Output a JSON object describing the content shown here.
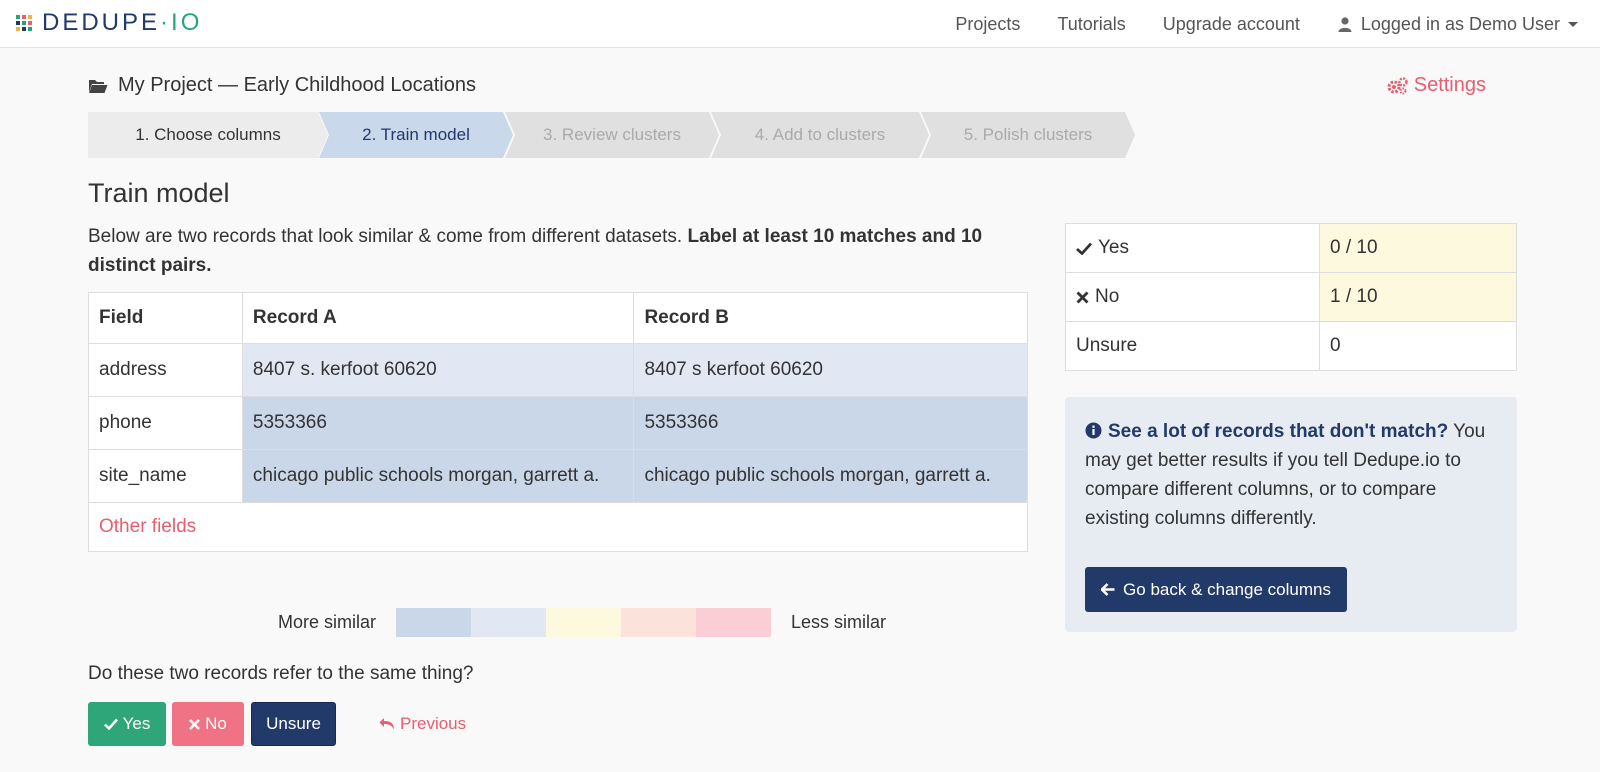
{
  "navbar": {
    "logo": {
      "main": "DEDUPE",
      "sep": "·",
      "suffix": "IO"
    },
    "links": [
      "Projects",
      "Tutorials",
      "Upgrade account"
    ],
    "user_label": "Logged in as Demo User"
  },
  "project": {
    "title": "My Project — Early Childhood Locations",
    "settings_label": "Settings"
  },
  "steps": [
    {
      "label": "1. Choose columns",
      "state": "done"
    },
    {
      "label": "2. Train model",
      "state": "active"
    },
    {
      "label": "3. Review clusters",
      "state": "pending"
    },
    {
      "label": "4. Add to clusters",
      "state": "pending"
    },
    {
      "label": "5. Polish clusters",
      "state": "pending"
    }
  ],
  "heading": "Train model",
  "intro": {
    "text": "Below are two records that look similar & come from different datasets. ",
    "bold": "Label at least 10 matches and 10 distinct pairs."
  },
  "compare": {
    "headers": [
      "Field",
      "Record A",
      "Record B"
    ],
    "rows": [
      {
        "field": "address",
        "a": "8407 s. kerfoot 60620",
        "b": "8407 s kerfoot 60620",
        "similarity": 2
      },
      {
        "field": "phone",
        "a": "5353366",
        "b": "5353366",
        "similarity": 1
      },
      {
        "field": "site_name",
        "a": "chicago public schools morgan, garrett a.",
        "b": "chicago public schools morgan, garrett a.",
        "similarity": 1
      }
    ],
    "other_fields_label": "Other fields"
  },
  "legend": {
    "more_label": "More similar",
    "less_label": "Less similar",
    "colors": [
      "#cad7e8",
      "#e2e8f3",
      "#fdf9df",
      "#fbe3db",
      "#fbcdd5"
    ]
  },
  "question": "Do these two records refer to the same thing?",
  "buttons": {
    "yes": "Yes",
    "no": "No",
    "unsure": "Unsure",
    "previous": "Previous"
  },
  "stats": [
    {
      "icon": "check-icon",
      "label": "Yes",
      "value": "0 / 10",
      "highlight": true
    },
    {
      "icon": "times-icon",
      "label": "No",
      "value": "1 / 10",
      "highlight": true
    },
    {
      "icon": "",
      "label": "Unsure",
      "value": "0",
      "highlight": false
    }
  ],
  "info": {
    "bold": "See a lot of records that don't match?",
    "text": " You may get better results if you tell Dedupe.io to compare different columns, or to compare existing columns differently.",
    "button": "Go back & change columns"
  },
  "colors": {
    "accent": "#e85d6f",
    "navy": "#223a6a",
    "green": "#2fa67a",
    "step_done": "#ececec",
    "step_active": "#c9d8ea",
    "step_pending": "#e0e0e0"
  }
}
